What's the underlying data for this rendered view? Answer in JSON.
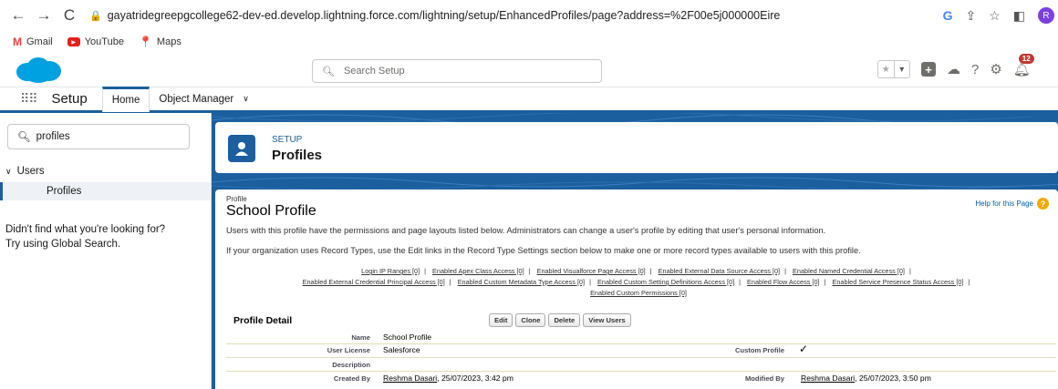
{
  "browser": {
    "url": "gayatridegreepgcollege62-dev-ed.develop.lightning.force.com/lightning/setup/EnhancedProfiles/page?address=%2F00e5j000000Eire",
    "profile_initial": "R",
    "bookmarks": [
      {
        "label": "Gmail"
      },
      {
        "label": "YouTube"
      },
      {
        "label": "Maps"
      }
    ]
  },
  "header": {
    "search_placeholder": "Search Setup",
    "notification_count": "12"
  },
  "context_bar": {
    "app_name": "Setup",
    "tabs": [
      {
        "label": "Home"
      },
      {
        "label": "Object Manager"
      }
    ]
  },
  "sidebar": {
    "search_value": "profiles",
    "group_label": "Users",
    "item_label": "Profiles",
    "help_text_1": "Didn't find what you're looking for?",
    "help_text_2": "Try using Global Search."
  },
  "page_header": {
    "eyebrow": "SETUP",
    "title": "Profiles"
  },
  "detail": {
    "small_label": "Profile",
    "title": "School Profile",
    "help_link": "Help for this Page",
    "description_1": "Users with this profile have the permissions and page layouts listed below. Administrators can change a user's profile by editing that user's personal information.",
    "description_2": "If your organization uses Record Types, use the Edit links in the Record Type Settings section below to make one or more record types available to users with this profile.",
    "links_row1": [
      "Login IP Ranges [0]",
      "Enabled Apex Class Access [0]",
      "Enabled Visualforce Page Access [0]",
      "Enabled External Data Source Access [0]",
      "Enabled Named Credential Access [0]"
    ],
    "links_row2": [
      "Enabled External Credential Principal Access [0]",
      "Enabled Custom Metadata Type Access [0]",
      "Enabled Custom Setting Definitions Access [0]",
      "Enabled Flow Access [0]",
      "Enabled Service Presence Status Access [0]"
    ],
    "links_row3": "Enabled Custom Permissions [0]",
    "section_title": "Profile Detail",
    "buttons": {
      "edit": "Edit",
      "clone": "Clone",
      "delete": "Delete",
      "view_users": "View Users"
    },
    "fields": {
      "name_label": "Name",
      "name_value": "School Profile",
      "license_label": "User License",
      "license_value": "Salesforce",
      "custom_label": "Custom Profile",
      "custom_value": "✓",
      "description_label": "Description",
      "created_label": "Created By",
      "created_user": "Reshma Dasari",
      "created_date": ", 25/07/2023, 3:42 pm",
      "modified_label": "Modified By",
      "modified_user": "Reshma Dasari",
      "modified_date": ", 25/07/2023, 3:50 pm"
    }
  }
}
